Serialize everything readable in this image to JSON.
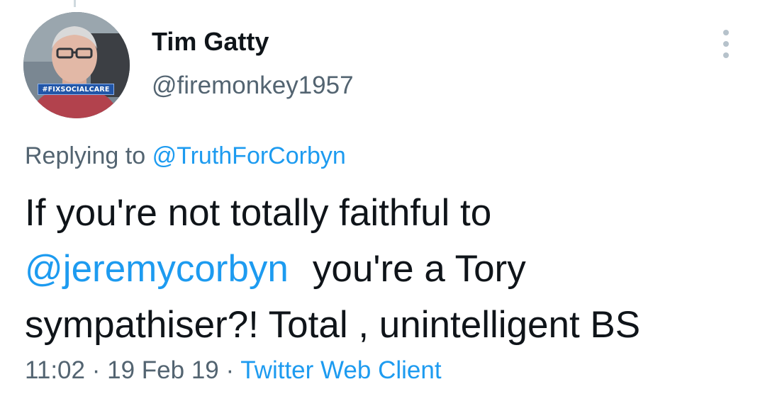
{
  "author": {
    "display_name": "Tim Gatty",
    "handle": "@firemonkey1957",
    "avatar_badge": "#FIXSOCIALCARE"
  },
  "reply": {
    "prefix": "Replying to",
    "to_handle": "@TruthForCorbyn"
  },
  "tweet": {
    "line1": "If you're not totally faithful to",
    "mention": "@jeremycorbyn",
    "line2_rest": "you're a Tory",
    "line3": "sympathiser?! Total , unintelligent BS"
  },
  "meta": {
    "time": "11:02",
    "date": "19 Feb 19",
    "separator": "·",
    "source": "Twitter Web Client"
  },
  "colors": {
    "text": "#0f1419",
    "secondary": "#536471",
    "link": "#1d9bf0"
  },
  "icons": {
    "more": "more-vertical-icon"
  }
}
